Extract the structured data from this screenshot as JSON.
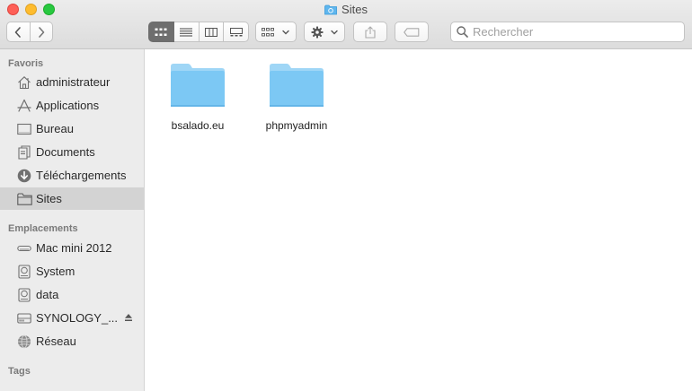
{
  "window": {
    "title": "Sites"
  },
  "toolbar": {
    "back_icon": "chevron-left-icon",
    "forward_icon": "chevron-right-icon",
    "view_modes": [
      "icon-view",
      "list-view",
      "column-view",
      "gallery-view"
    ],
    "active_view": "icon-view",
    "search_placeholder": "Rechercher"
  },
  "sidebar": {
    "favorites_title": "Favoris",
    "favorites": [
      {
        "label": "administrateur",
        "icon": "home-icon"
      },
      {
        "label": "Applications",
        "icon": "applications-icon"
      },
      {
        "label": "Bureau",
        "icon": "desktop-icon"
      },
      {
        "label": "Documents",
        "icon": "document-icon"
      },
      {
        "label": "Téléchargements",
        "icon": "download-icon"
      },
      {
        "label": "Sites",
        "icon": "folder-icon",
        "selected": true
      }
    ],
    "locations_title": "Emplacements",
    "locations": [
      {
        "label": "Mac mini 2012",
        "icon": "computer-icon"
      },
      {
        "label": "System",
        "icon": "disk-icon"
      },
      {
        "label": "data",
        "icon": "disk-icon"
      },
      {
        "label": "SYNOLOGY_...",
        "icon": "server-icon",
        "eject": true
      },
      {
        "label": "Réseau",
        "icon": "network-icon"
      }
    ],
    "tags_title": "Tags"
  },
  "content": {
    "files": [
      {
        "name": "bsalado.eu",
        "icon": "folder-icon"
      },
      {
        "name": "phpmyadmin",
        "icon": "folder-icon"
      }
    ]
  },
  "colors": {
    "folder": "#7cc8f4",
    "folder_tab": "#9fd6f6",
    "sidebar_bg": "#ececec",
    "selection": "#d3d3d3"
  }
}
